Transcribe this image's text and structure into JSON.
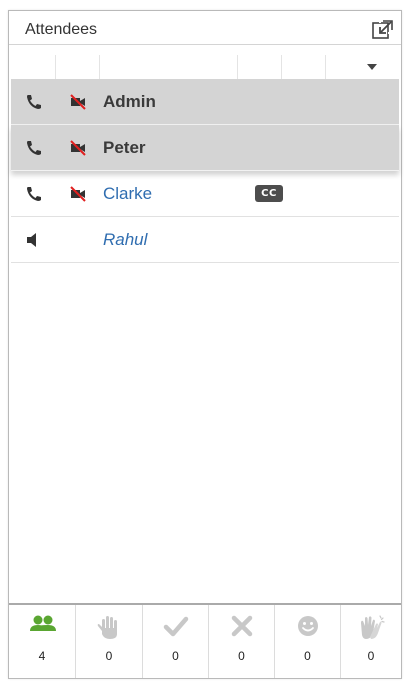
{
  "panel": {
    "title": "Attendees"
  },
  "attendees": [
    {
      "name": "Admin",
      "selected": true,
      "style": "bold",
      "cc": false
    },
    {
      "name": "Peter",
      "selected": true,
      "style": "bold",
      "cc": false
    },
    {
      "name": "Clarke",
      "selected": false,
      "style": "link",
      "cc": true,
      "cc_label": "CC"
    },
    {
      "name": "Rahul",
      "selected": false,
      "style": "italic",
      "cc": false
    }
  ],
  "footer": {
    "counts": [
      {
        "icon": "attendees-icon",
        "value": "4",
        "color": "#5aa632"
      },
      {
        "icon": "raise-hand-icon",
        "value": "0",
        "color": "#c8c8c8"
      },
      {
        "icon": "agree-check-icon",
        "value": "0",
        "color": "#c8c8c8"
      },
      {
        "icon": "disagree-x-icon",
        "value": "0",
        "color": "#c8c8c8"
      },
      {
        "icon": "smiley-icon",
        "value": "0",
        "color": "#c8c8c8"
      },
      {
        "icon": "applause-icon",
        "value": "0",
        "color": "#c8c8c8"
      }
    ]
  },
  "colors": {
    "selected_row": "#d4d4d4",
    "link_name": "#2f6db0",
    "video_off_red": "#e02020"
  }
}
